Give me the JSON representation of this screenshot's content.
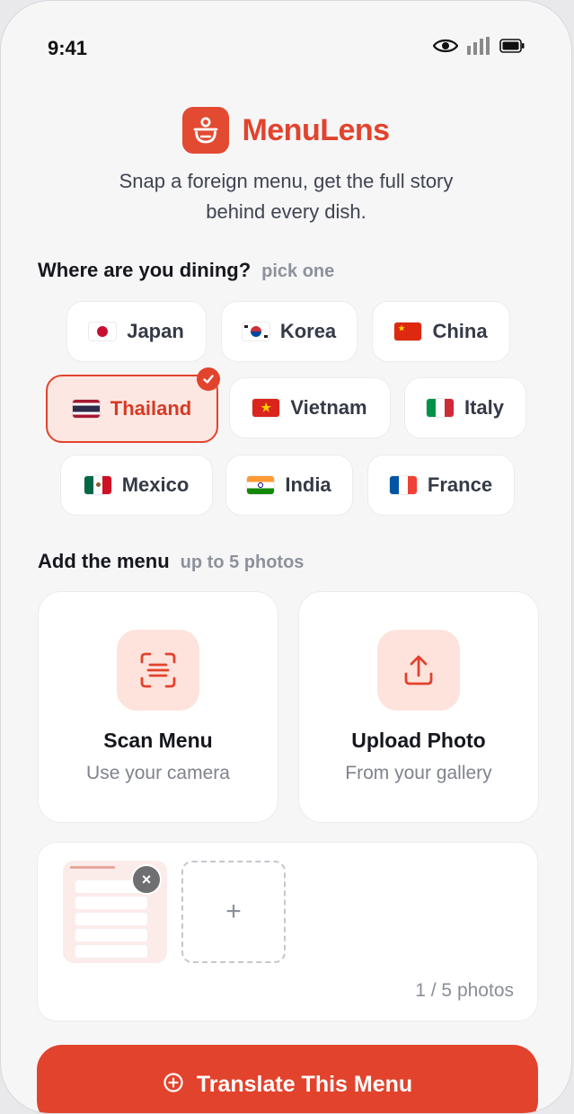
{
  "status": {
    "time": "9:41"
  },
  "app": {
    "name": "MenuLens",
    "tagline_line1": "Snap a foreign menu, get the full story",
    "tagline_line2": "behind every dish."
  },
  "dining": {
    "title": "Where are you dining?",
    "hint": "pick one",
    "countries": [
      "Japan",
      "Korea",
      "China",
      "Thailand",
      "Vietnam",
      "Italy",
      "Mexico",
      "India",
      "France"
    ],
    "selected": "Thailand"
  },
  "menu": {
    "title": "Add the menu",
    "hint": "up to 5 photos",
    "scan": {
      "title": "Scan Menu",
      "subtitle": "Use your camera"
    },
    "upload": {
      "title": "Upload Photo",
      "subtitle": "From your gallery"
    }
  },
  "tray": {
    "add_symbol": "+",
    "remove_symbol": "×",
    "count": "1 / 5 photos"
  },
  "cta": {
    "label": "Translate This Menu"
  },
  "colors": {
    "accent": "#e2432c",
    "accent_soft": "#fde3dc"
  }
}
